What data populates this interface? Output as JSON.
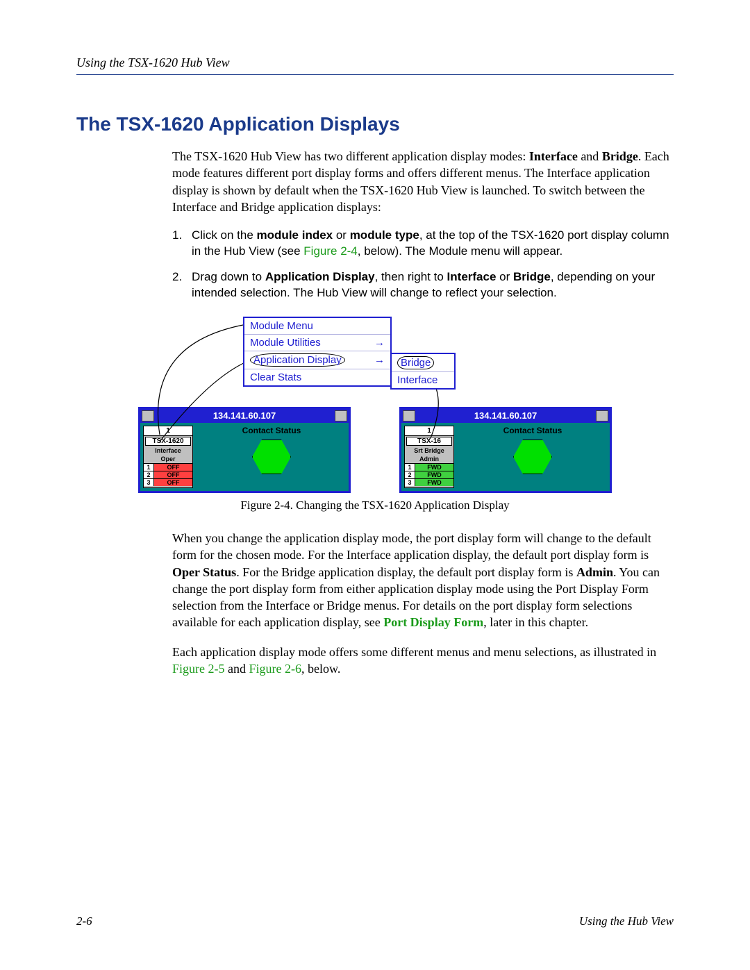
{
  "header": {
    "running_head": "Using the TSX-1620 Hub View"
  },
  "section": {
    "title": "The TSX-1620 Application Displays"
  },
  "intro": {
    "pre": "The TSX-1620 Hub View has two different application display modes: ",
    "b1": "Interface",
    "mid1": " and ",
    "b2": "Bridge",
    "post": ". Each mode features different port display forms and offers different menus. The Interface application display is shown by default when the TSX-1620 Hub View is launched. To switch between the Interface and Bridge application displays:"
  },
  "step1": {
    "num": "1.",
    "t1": "Click on the ",
    "b1": "module index",
    "t2": " or ",
    "b2": "module type",
    "t3": ", at the top of the TSX-1620 port display column in the Hub View (see ",
    "link": "Figure 2-4",
    "t4": ", below). The Module menu will appear."
  },
  "step2": {
    "num": "2.",
    "t1": "Drag down to ",
    "b1": "Application Display",
    "t2": ", then right to ",
    "b2": "Interface",
    "t3": " or ",
    "b3": "Bridge",
    "t4": ", depending on your intended selection. The Hub View will change to reflect your selection."
  },
  "figure": {
    "menu": {
      "title": "Module Menu",
      "item1": "Module Utilities",
      "item2": "Application Display",
      "item3": "Clear Stats"
    },
    "submenu": {
      "item1": "Bridge",
      "item2": "Interface"
    },
    "hub_ip": "134.141.60.107",
    "contact": "Contact Status",
    "left": {
      "slot": "1",
      "model": "TSX-1620",
      "mode1": "Interface",
      "mode2": "Oper",
      "rows": [
        {
          "n": "1",
          "s": "OFF"
        },
        {
          "n": "2",
          "s": "OFF"
        },
        {
          "n": "3",
          "s": "OFF"
        }
      ]
    },
    "right": {
      "slot": "1",
      "model": "TSX-16",
      "mode1": "Srt Bridge",
      "mode2": "Admin",
      "rows": [
        {
          "n": "1",
          "s": "FWD"
        },
        {
          "n": "2",
          "s": "FWD"
        },
        {
          "n": "3",
          "s": "FWD"
        }
      ]
    },
    "caption": "Figure 2-4. Changing the TSX-1620 Application Display"
  },
  "para2": {
    "t1": "When you change the application display mode, the port display form will change to the default form for the chosen mode. For the Interface application display, the default port display form is ",
    "b1": "Oper Status",
    "t2": ". For the Bridge application display, the default port display form is ",
    "b2": "Admin",
    "t3": ". You can change the port display form from either application display mode using the Port Display Form selection from the Interface or Bridge menus. For details on the port display form selections available for each application display, see ",
    "link": "Port Display Form",
    "t4": ", later in this chapter."
  },
  "para3": {
    "t1": "Each application display mode offers some different menus and menu selections, as illustrated in ",
    "link1": "Figure 2-5",
    "t2": " and ",
    "link2": "Figure 2-6",
    "t3": ", below."
  },
  "footer": {
    "page": "2-6",
    "section": "Using the Hub View"
  }
}
